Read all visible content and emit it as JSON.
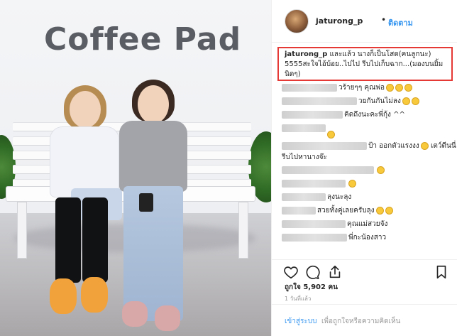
{
  "photo": {
    "sign_text": "Coffee Pad"
  },
  "post": {
    "username": "jaturong_p",
    "separator": "•",
    "follow_label": "ติดตาม",
    "caption_user": "jaturong_p",
    "caption_text": " และแล้ว นางก็เป็นโสด(คนลูกนะ) 5555สะใจไอ้บ้อย..ไปไป รีบไปเก็บฉาก...(มองบนยิ้มนิดๆ)"
  },
  "comments": [
    {
      "text": "วร้ายๆๆ คุณพ่อ",
      "emoji_count": 3
    },
    {
      "text": "วยกันกันไม่ลง",
      "emoji_count": 2
    },
    {
      "text": "คิดถึงนะคะพี่กุ้ง ^^",
      "emoji_count": 0
    },
    {
      "text": "",
      "emoji_count": 1
    },
    {
      "text": "ป้า ออกตัวแรงงง",
      "emoji_count": 1
    },
    {
      "text": "เตว์ดีนนี่",
      "emoji_count": 0
    },
    {
      "text": "รีบไปหานางจ๊ะ",
      "emoji_count": 0
    },
    {
      "text": "",
      "emoji_count": 1
    },
    {
      "text": "",
      "emoji_count": 1
    },
    {
      "text": "ลุงนะลุง",
      "emoji_count": 0
    },
    {
      "text": "สวยทั้งคู่เลยครับลุง",
      "emoji_count": 2
    },
    {
      "text": "คุณแม่สวยจัง",
      "emoji_count": 0
    },
    {
      "text": "พี่กะน้องสาว",
      "emoji_count": 0
    }
  ],
  "actions": {
    "like_icon": "heart-icon",
    "comment_icon": "comment-icon",
    "share_icon": "share-icon",
    "save_icon": "bookmark-icon"
  },
  "likes_text": "ถูกใจ 5,902 คน",
  "time_text": "1 วันที่แล้ว",
  "footer": {
    "login_label": "เข้าสู่ระบบ",
    "tail_text": " เพื่อถูกใจหรือความคิดเห็น"
  },
  "colors": {
    "accent": "#3897f0",
    "highlight_border": "#e53935"
  }
}
